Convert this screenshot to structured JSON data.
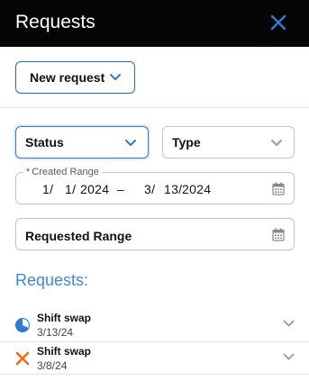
{
  "header": {
    "title": "Requests",
    "close_icon": "close-icon",
    "accent": "#2d7ad6"
  },
  "toolbar": {
    "new_request_label": "New request"
  },
  "filters": {
    "status_label": "Status",
    "type_label": "Type",
    "created_range": {
      "required_mark": "*",
      "label": "Created Range",
      "start_month": "1/",
      "start_day": "1/",
      "start_year": "2024",
      "separator": "–",
      "end_month": "3/",
      "end_day": "13/",
      "end_year": "2024"
    },
    "requested_range_label": "Requested Range"
  },
  "requests": {
    "heading": "Requests:",
    "items": [
      {
        "title": "Shift swap",
        "date": "3/13/24",
        "status_icon": "pending-clock-icon",
        "status_color": "#2d7ad6"
      },
      {
        "title": "Shift swap",
        "date": "3/8/24",
        "status_icon": "rejected-x-icon",
        "status_color": "#ef6a12"
      }
    ]
  }
}
